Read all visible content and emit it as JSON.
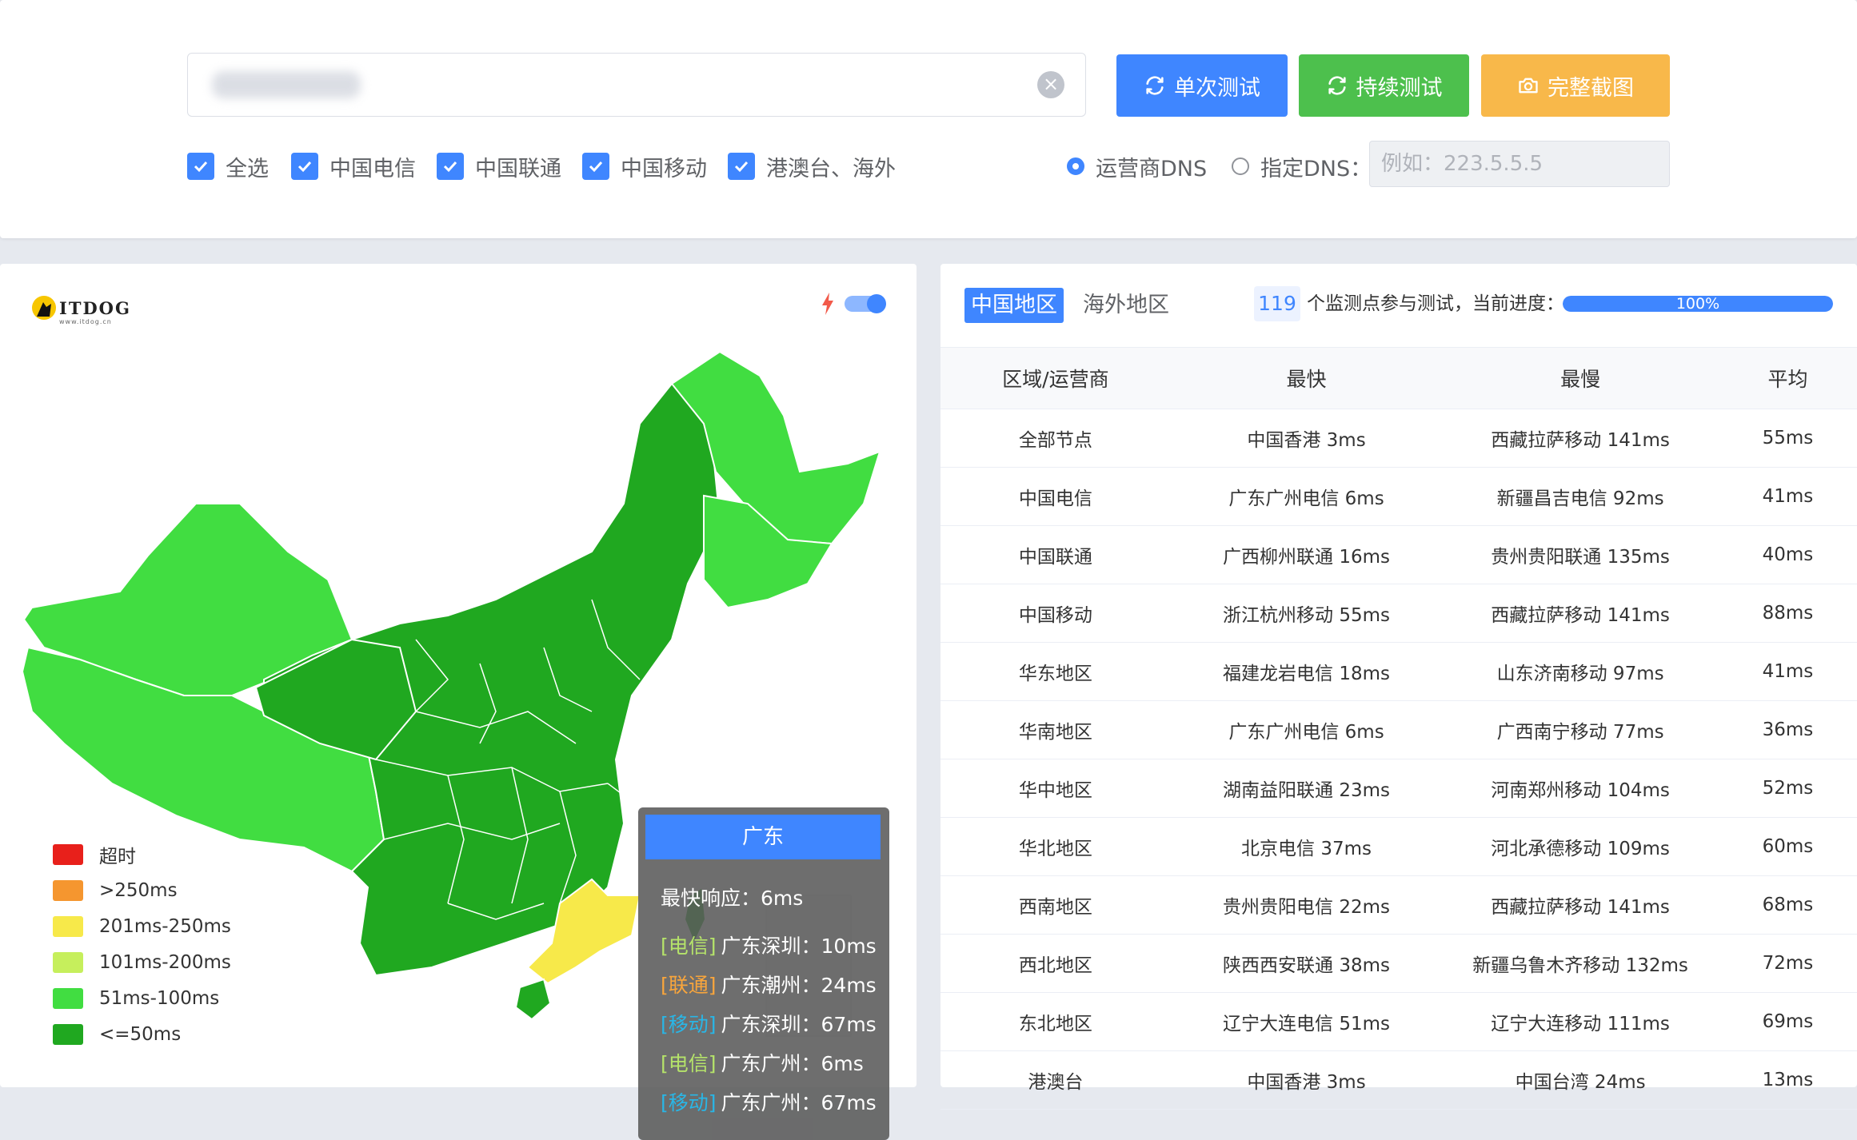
{
  "toolbar": {
    "url_value": "",
    "btn_single": "单次测试",
    "btn_continuous": "持续测试",
    "btn_screenshot": "完整截图",
    "filters": [
      "全选",
      "中国电信",
      "中国联通",
      "中国移动",
      "港澳台、海外"
    ],
    "radio_isp": "运营商DNS",
    "radio_custom": "指定DNS：",
    "dns_placeholder": "例如：223.5.5.5"
  },
  "map": {
    "logo_text": "ITDOG",
    "logo_sub": "www.itdog.cn",
    "tooltip": {
      "title": "广东",
      "fastest": "最快响应：6ms",
      "rows": [
        {
          "tag": "[电信]",
          "text": "广东深圳：10ms",
          "color": "#b5e36a"
        },
        {
          "tag": "[联通]",
          "text": "广东潮州：24ms",
          "color": "#f8a53c"
        },
        {
          "tag": "[移动]",
          "text": "广东深圳：67ms",
          "color": "#29b6e6"
        },
        {
          "tag": "[电信]",
          "text": "广东广州：6ms",
          "color": "#b5e36a"
        },
        {
          "tag": "[移动]",
          "text": "广东广州：67ms",
          "color": "#29b6e6"
        }
      ]
    },
    "legend": [
      {
        "label": "超时",
        "color": "#e8201b"
      },
      {
        "label": ">250ms",
        "color": "#f5962f"
      },
      {
        "label": "201ms-250ms",
        "color": "#f7e94a"
      },
      {
        "label": "101ms-200ms",
        "color": "#c6ef5c"
      },
      {
        "label": "51ms-100ms",
        "color": "#41dd41"
      },
      {
        "label": "<=50ms",
        "color": "#20a820"
      }
    ]
  },
  "results": {
    "tab_china": "中国地区",
    "tab_overseas": "海外地区",
    "count": "119",
    "count_text": "个监测点参与测试，当前进度：",
    "progress_label": "100%",
    "progress_value": 100,
    "headers": [
      "区域/运营商",
      "最快",
      "最慢",
      "平均"
    ],
    "rows": [
      [
        "全部节点",
        "中国香港 3ms",
        "西藏拉萨移动 141ms",
        "55ms"
      ],
      [
        "中国电信",
        "广东广州电信 6ms",
        "新疆昌吉电信 92ms",
        "41ms"
      ],
      [
        "中国联通",
        "广西柳州联通 16ms",
        "贵州贵阳联通 135ms",
        "40ms"
      ],
      [
        "中国移动",
        "浙江杭州移动 55ms",
        "西藏拉萨移动 141ms",
        "88ms"
      ],
      [
        "华东地区",
        "福建龙岩电信 18ms",
        "山东济南移动 97ms",
        "41ms"
      ],
      [
        "华南地区",
        "广东广州电信 6ms",
        "广西南宁移动 77ms",
        "36ms"
      ],
      [
        "华中地区",
        "湖南益阳联通 23ms",
        "河南郑州移动 104ms",
        "52ms"
      ],
      [
        "华北地区",
        "北京电信 37ms",
        "河北承德移动 109ms",
        "60ms"
      ],
      [
        "西南地区",
        "贵州贵阳电信 22ms",
        "西藏拉萨移动 141ms",
        "68ms"
      ],
      [
        "西北地区",
        "陕西西安联通 38ms",
        "新疆乌鲁木齐移动 132ms",
        "72ms"
      ],
      [
        "东北地区",
        "辽宁大连电信 51ms",
        "辽宁大连移动 111ms",
        "69ms"
      ],
      [
        "港澳台",
        "中国香港 3ms",
        "中国台湾 24ms",
        "13ms"
      ]
    ]
  }
}
